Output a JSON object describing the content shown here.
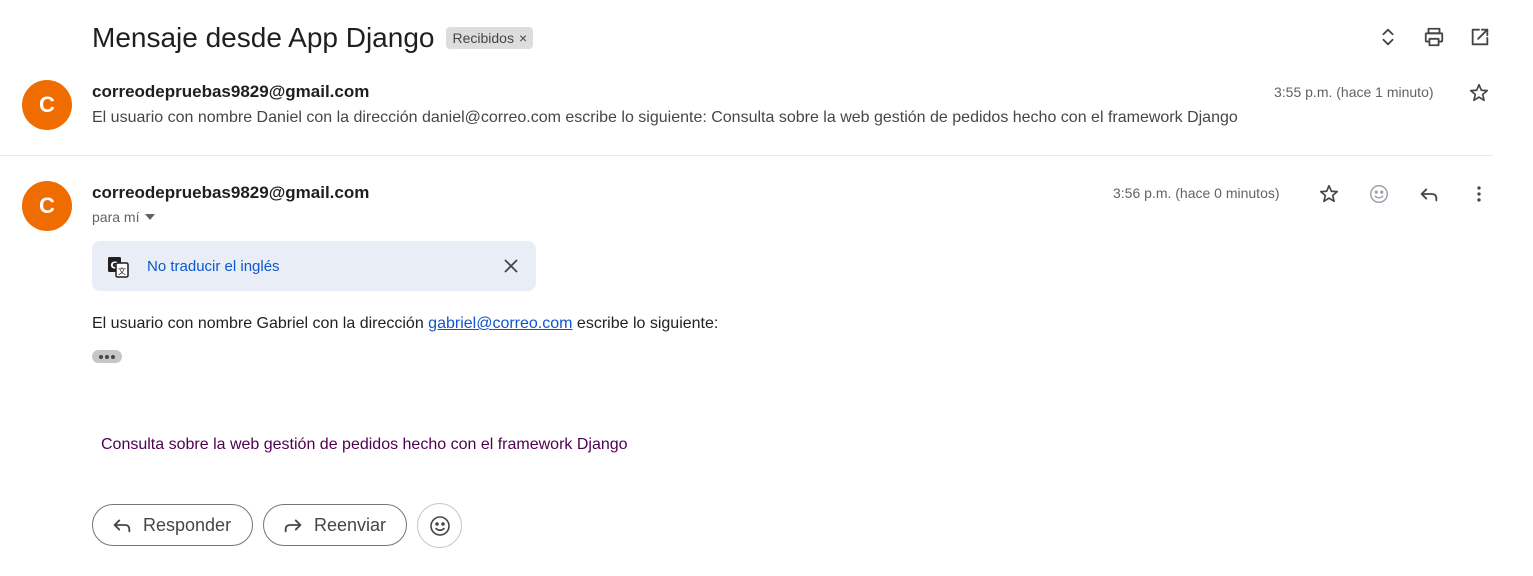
{
  "subject": "Mensaje desde App Django",
  "label_chip": {
    "text": "Recibidos",
    "close": "×"
  },
  "top_actions": [
    "expand-collapse-icon",
    "print-icon",
    "open-new-window-icon"
  ],
  "messages": [
    {
      "avatar_letter": "C",
      "sender": "correodepruebas9829@gmail.com",
      "snippet": "El usuario con nombre Daniel con la dirección daniel@correo.com escribe lo siguiente: Consulta sobre la web gestión de pedidos hecho con el framework Django",
      "time": "3:55 p.m. (hace 1 minuto)"
    },
    {
      "avatar_letter": "C",
      "sender": "correodepruebas9829@gmail.com",
      "to": "para mí",
      "time": "3:56 p.m. (hace 0 minutos)",
      "translate_bar": {
        "text": "No traducir el inglés"
      },
      "body": {
        "prefix": "El usuario con nombre Gabriel con la dirección ",
        "link": "gabriel@correo.com",
        "suffix": " escribe lo siguiente:"
      },
      "quoted": "Consulta sobre la web gestión de pedidos hecho con el framework Django"
    }
  ],
  "actions": {
    "reply": "Responder",
    "forward": "Reenviar"
  },
  "colors": {
    "avatar": "#ef6c00",
    "link": "#1155cc",
    "translate_bg": "#e9eef6",
    "translate_text": "#0b57d0",
    "quoted_text": "#500050"
  }
}
